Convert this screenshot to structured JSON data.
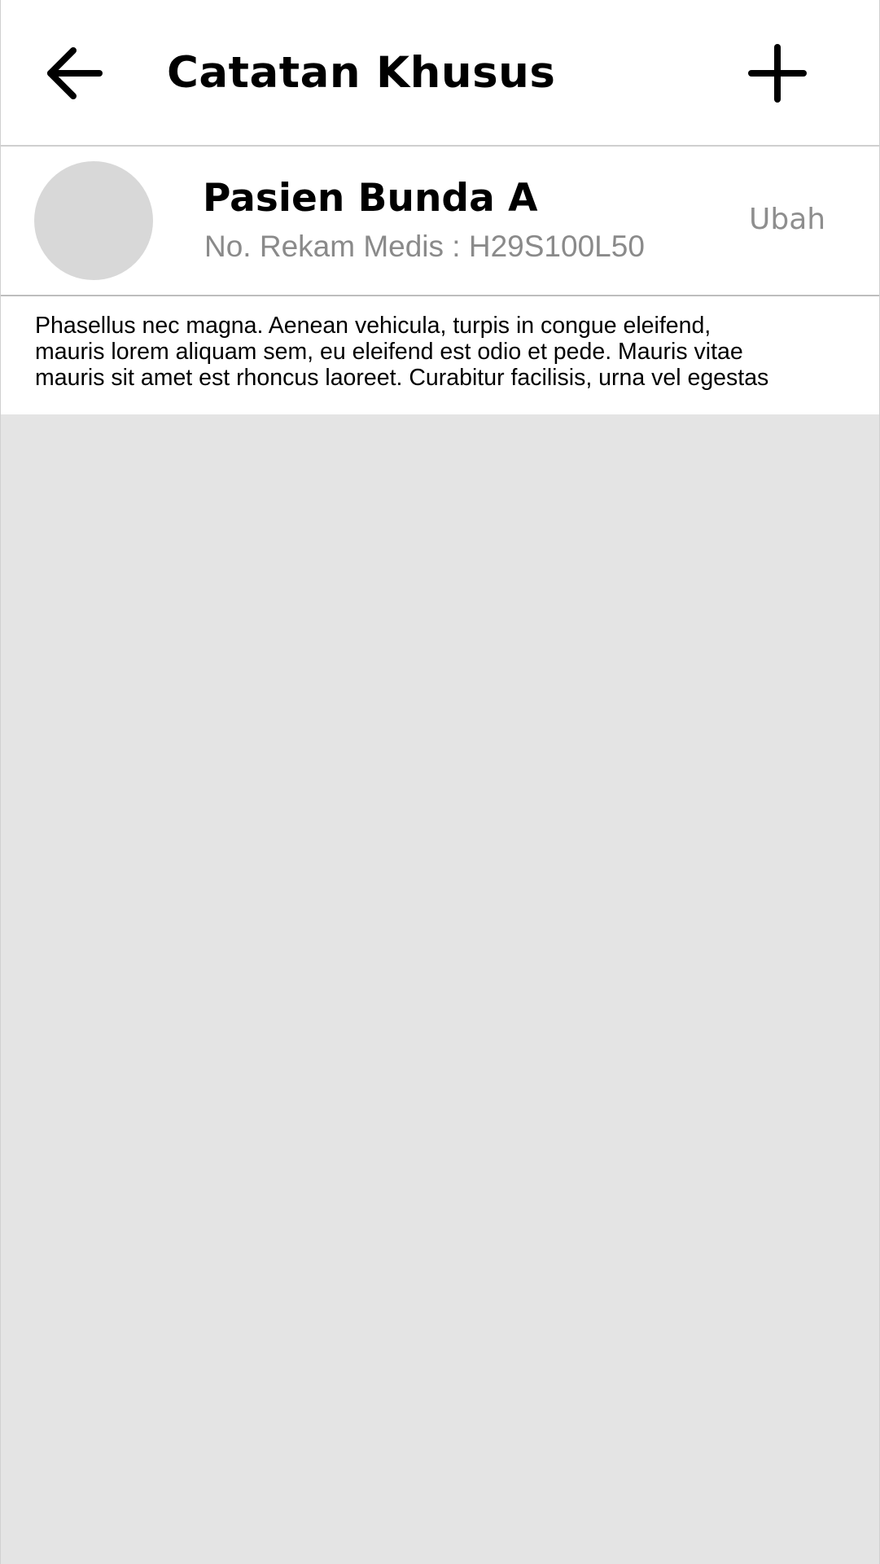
{
  "header": {
    "title": "Catatan Khusus",
    "back_icon": "arrow-left-icon",
    "add_icon": "plus-icon"
  },
  "patient": {
    "name": "Pasien Bunda A",
    "record_number": "No. Rekam Medis : H29S100L50",
    "edit_label": "Ubah",
    "avatar_icon": "avatar-placeholder"
  },
  "note": {
    "lines": [
      "Phasellus nec magna. Aenean vehicula, turpis in congue eleifend,",
      "mauris lorem aliquam sem, eu eleifend est odio et pede. Mauris vitae",
      "mauris sit amet est rhoncus laoreet. Curabitur facilisis, urna vel egestas"
    ]
  },
  "colors": {
    "background": "#e4e4e4",
    "surface": "#ffffff",
    "text_primary": "#000000",
    "text_secondary": "#8a8a8a",
    "avatar": "#d8d8d8"
  }
}
